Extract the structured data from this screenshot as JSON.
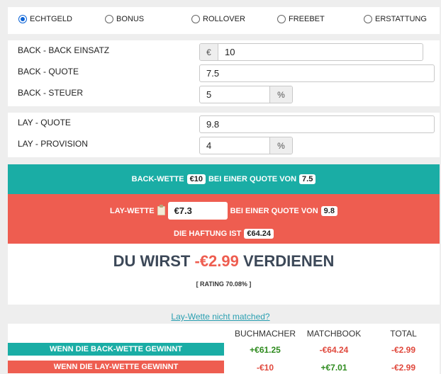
{
  "bet_type": {
    "options": [
      {
        "label": "ECHTGELD",
        "checked": true
      },
      {
        "label": "BONUS",
        "checked": false
      },
      {
        "label": "ROLLOVER",
        "checked": false
      },
      {
        "label": "FREEBET",
        "checked": false
      },
      {
        "label": "ERSTATTUNG",
        "checked": false
      }
    ]
  },
  "back": {
    "stake_label": "BACK - BACK EINSATZ",
    "currency": "€",
    "stake_value": "10",
    "odds_label": "BACK - QUOTE",
    "odds_value": "7.5",
    "tax_label": "BACK - STEUER",
    "tax_value": "5",
    "tax_unit": "%"
  },
  "lay": {
    "odds_label": "LAY - QUOTE",
    "odds_value": "9.8",
    "commission_label": "LAY - PROVISION",
    "commission_value": "4",
    "commission_unit": "%"
  },
  "summary": {
    "back_prefix": "BACK-WETTE",
    "back_stake": "€10",
    "back_mid": "BEI EINER QUOTE VON",
    "back_odds": "7.5",
    "lay_prefix": "LAY-WETTE",
    "lay_stake": "€7.3",
    "lay_mid": "BEI EINER QUOTE VON",
    "lay_odds": "9.8",
    "liability_label": "DIE HAFTUNG IST",
    "liability_value": "€64.24"
  },
  "result": {
    "prefix": "DU WIRST",
    "amount": "-€2.99",
    "suffix": "VERDIENEN",
    "rating": "[ RATING 70.08% ]"
  },
  "not_matched_link": "Lay-Wette nicht matched?",
  "table": {
    "headers": [
      "BUCHMACHER",
      "MATCHBOOK",
      "TOTAL"
    ],
    "rows": [
      {
        "label": "WENN DIE BACK-WETTE GEWINNT",
        "bookmaker": "+€61.25",
        "exchange": "-€64.24",
        "total": "-€2.99"
      },
      {
        "label": "WENN DIE LAY-WETTE GEWINNT",
        "bookmaker": "-€10",
        "exchange": "+€7.01",
        "total": "-€2.99"
      }
    ]
  },
  "colors": {
    "teal": "#1aada5",
    "red": "#ee5d50",
    "radio_accent": "#0b63d6"
  }
}
